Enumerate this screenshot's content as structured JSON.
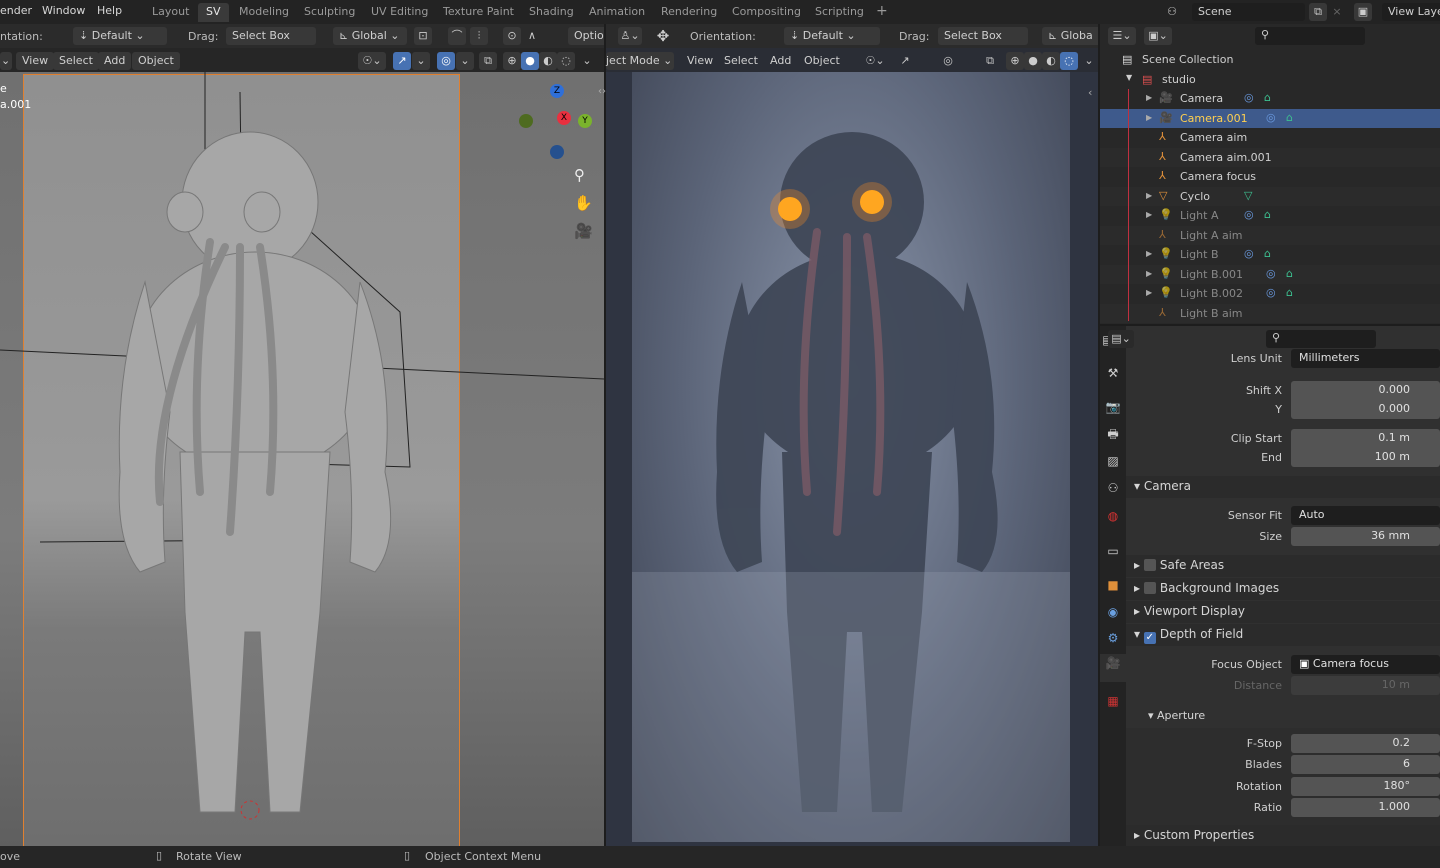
{
  "topbar": {
    "menus": [
      "ender",
      "Window",
      "Help"
    ],
    "workspace_tabs": [
      "Layout",
      "SV",
      "Modeling",
      "Sculpting",
      "UV Editing",
      "Texture Paint",
      "Shading",
      "Animation",
      "Rendering",
      "Compositing",
      "Scripting"
    ],
    "active_tab": "SV",
    "add_tab": "+",
    "scene": "Scene",
    "view_layer": "View Laye"
  },
  "left_viewport": {
    "orientation_label": "ntation:",
    "orientation_value": "Default",
    "drag_label": "Drag:",
    "drag_value": "Select Box",
    "transform_orientation": "Global",
    "options": "Optio",
    "menus": [
      "View",
      "Select",
      "Add",
      "Object"
    ],
    "overlay_text": [
      "e",
      "a.001"
    ],
    "gizmo_axes": [
      "Z",
      "X",
      "Y"
    ]
  },
  "right_viewport": {
    "orientation_label": "Orientation:",
    "orientation_value": "Default",
    "drag_label": "Drag:",
    "drag_value": "Select Box",
    "transform_orientation": "Globa",
    "mode": "ject Mode",
    "menus": [
      "View",
      "Select",
      "Add",
      "Object"
    ]
  },
  "outliner": {
    "root": "Scene Collection",
    "collection": "studio",
    "items": [
      {
        "name": "Camera",
        "type": "camera",
        "expandable": true,
        "dim": false,
        "selected": false
      },
      {
        "name": "Camera.001",
        "type": "camera",
        "expandable": true,
        "dim": false,
        "selected": true
      },
      {
        "name": "Camera aim",
        "type": "empty",
        "expandable": false,
        "dim": false,
        "selected": false
      },
      {
        "name": "Camera aim.001",
        "type": "empty",
        "expandable": false,
        "dim": false,
        "selected": false
      },
      {
        "name": "Camera focus",
        "type": "empty",
        "expandable": false,
        "dim": false,
        "selected": false
      },
      {
        "name": "Cyclo",
        "type": "mesh",
        "expandable": true,
        "dim": false,
        "selected": false
      },
      {
        "name": "Light A",
        "type": "light",
        "expandable": true,
        "dim": true,
        "selected": false
      },
      {
        "name": "Light A aim",
        "type": "empty",
        "expandable": false,
        "dim": true,
        "selected": false
      },
      {
        "name": "Light B",
        "type": "light",
        "expandable": true,
        "dim": true,
        "selected": false
      },
      {
        "name": "Light B.001",
        "type": "light",
        "expandable": true,
        "dim": true,
        "selected": false
      },
      {
        "name": "Light B.002",
        "type": "light",
        "expandable": true,
        "dim": true,
        "selected": false
      },
      {
        "name": "Light B aim",
        "type": "empty",
        "expandable": false,
        "dim": true,
        "selected": false
      }
    ]
  },
  "properties": {
    "lens_unit_label": "Lens Unit",
    "lens_unit": "Millimeters",
    "shift_x_label": "Shift X",
    "shift_x": "0.000",
    "shift_y_label": "Y",
    "shift_y": "0.000",
    "clip_start_label": "Clip Start",
    "clip_start": "0.1 m",
    "clip_end_label": "End",
    "clip_end": "100 m",
    "camera_section": "Camera",
    "sensor_fit_label": "Sensor Fit",
    "sensor_fit": "Auto",
    "size_label": "Size",
    "size": "36 mm",
    "safe_areas": "Safe Areas",
    "background_images": "Background Images",
    "viewport_display": "Viewport Display",
    "depth_of_field": "Depth of Field",
    "focus_object_label": "Focus Object",
    "focus_object": "Camera focus",
    "distance_label": "Distance",
    "distance": "10 m",
    "aperture": "Aperture",
    "fstop_label": "F-Stop",
    "fstop": "0.2",
    "blades_label": "Blades",
    "blades": "6",
    "rotation_label": "Rotation",
    "rotation": "180°",
    "ratio_label": "Ratio",
    "ratio": "1.000",
    "custom_properties": "Custom Properties"
  },
  "statusbar": {
    "left": "ove",
    "middle": "Rotate View",
    "right": "Object Context Menu"
  },
  "colors": {
    "selection": "#3e5a8c",
    "accent_blue": "#4772b3",
    "eye_glow": "#ffb020",
    "collection_red": "#e05050",
    "object_orange": "#e0903a"
  }
}
